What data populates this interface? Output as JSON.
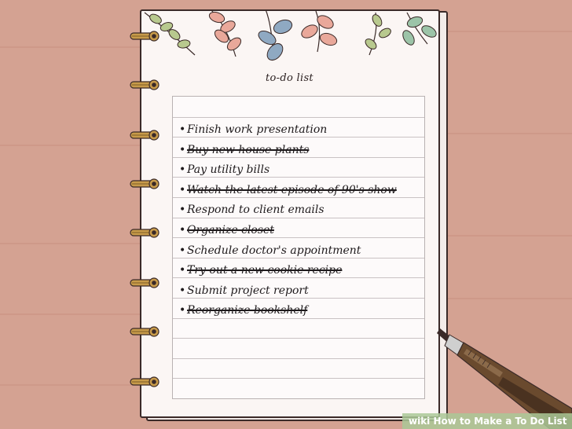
{
  "page_title": "to-do list",
  "todo_items": [
    {
      "text": "Finish work presentation",
      "done": false
    },
    {
      "text": "Buy new house plants",
      "done": true
    },
    {
      "text": "Pay utility bills",
      "done": false
    },
    {
      "text": "Watch the latest episode of 90's show",
      "done": true
    },
    {
      "text": "Respond to client emails",
      "done": false
    },
    {
      "text": "Organize closet",
      "done": true
    },
    {
      "text": "Schedule doctor's appointment",
      "done": false
    },
    {
      "text": "Try out a new cookie recipe",
      "done": true
    },
    {
      "text": "Submit project report",
      "done": false
    },
    {
      "text": "Reorganize bookshelf",
      "done": true
    }
  ],
  "bullet": "•",
  "watermark": {
    "brand": "wiki",
    "text": "How to Make a To Do List"
  },
  "colors": {
    "table": "#d4a292",
    "paper": "#fbf6f4",
    "outline": "#3a2a28",
    "leaf_blue": "#8fa9c2",
    "leaf_pink": "#e9a89a",
    "leaf_green": "#b8c98e",
    "leaf_mint": "#9cc4a8",
    "ring": "#c89b4a"
  }
}
